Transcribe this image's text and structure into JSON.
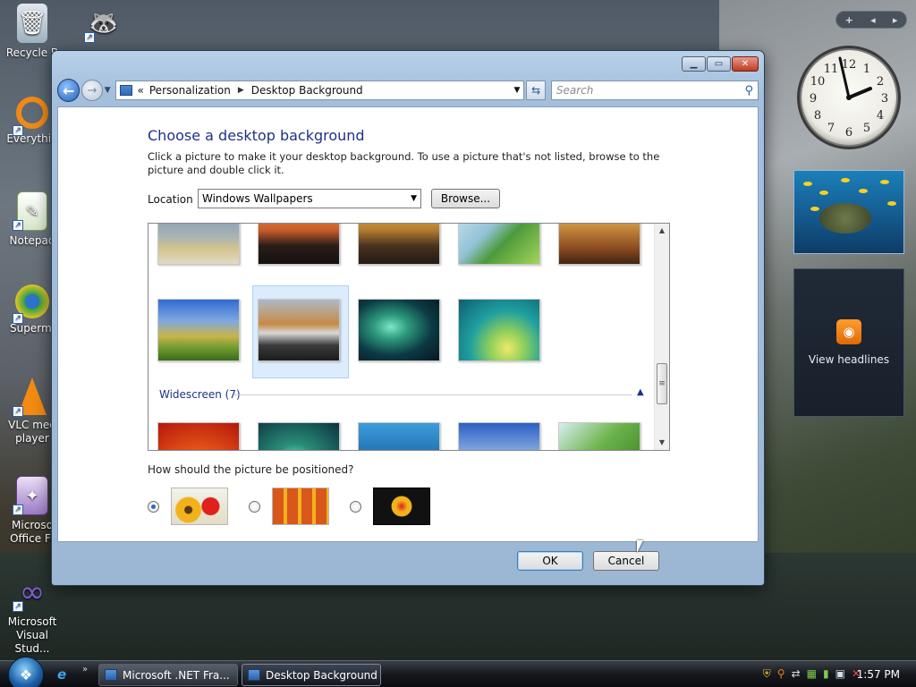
{
  "desktop": {
    "icons": [
      {
        "label": "Recycle B"
      },
      {
        "label": "Everythin"
      },
      {
        "label": "Notepad"
      },
      {
        "label": "Supermi"
      },
      {
        "label": "VLC med player"
      },
      {
        "label": "Microso Office Fr"
      },
      {
        "label": "Microsoft Visual Stud..."
      }
    ]
  },
  "gadgets": {
    "sidebar_add": "+",
    "clock_numbers": [
      "12",
      "1",
      "2",
      "3",
      "4",
      "5",
      "6",
      "7",
      "8",
      "9",
      "10",
      "11"
    ],
    "feed_label": "View headlines"
  },
  "window": {
    "breadcrumb": [
      "Personalization",
      "Desktop Background"
    ],
    "search_placeholder": "Search",
    "title": "Choose a desktop background",
    "description": "Click a picture to make it your desktop background. To use a picture that's not listed, browse to the picture and double click it.",
    "location_label": "Location",
    "location_value": "Windows Wallpapers",
    "browse_label": "Browse...",
    "widescreen_label": "Widescreen (7)",
    "position_question": "How should the picture be positioned?",
    "ok_label": "OK",
    "cancel_label": "Cancel"
  },
  "taskbar": {
    "tasks": [
      "Microsoft .NET Fra...",
      "Desktop Background"
    ],
    "time": "1:57 PM"
  },
  "colors": {
    "link_blue": "#1e3287",
    "selection": "#dcecfc"
  }
}
